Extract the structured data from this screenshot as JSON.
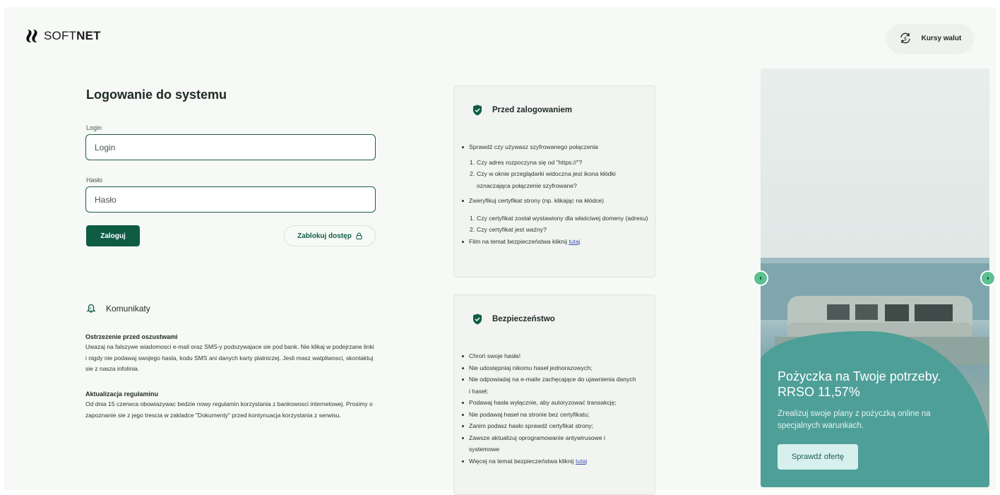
{
  "brand": {
    "name_light": "SOFT",
    "name_bold": "NET"
  },
  "header": {
    "fx_label": "Kursy walut",
    "fx_icon": "currency-exchange-icon"
  },
  "login": {
    "title": "Logowanie do systemu",
    "login_label": "Login",
    "login_placeholder": "Login",
    "password_label": "Hasło",
    "password_placeholder": "Hasło",
    "submit_label": "Zaloguj",
    "block_label": "Zablokuj dostęp",
    "block_icon": "lock-icon"
  },
  "messages": {
    "title": "Komunikaty",
    "icon": "bell-icon",
    "items": [
      {
        "title": "Ostrzezenie przed oszustwami",
        "body": "Uwazaj na falszywe wiadomosci e-mail oraz SMS-y podszywajace sie pod bank. Nie klikaj w podejrzane linki i nigdy nie podawaj swojego hasla, kodu SMS ani danych karty platniczej. Jesli masz watpliwosci, skontaktuj sie z nasza infolinia."
      },
      {
        "title": "Aktualizacja regulaminu",
        "body": "Od dnia 15 czerwca obowiazywac bedzie nowy regulamin korzystania z bankowosci internetowej. Prosimy o zapoznanie sie z jego trescia w zakladce \"Dokumenty\" przed kontynuacja korzystania z serwisu."
      }
    ]
  },
  "before_login": {
    "title": "Przed zalogowaniem",
    "icon": "shield-check-icon",
    "b1": "Sprawdź czy używasz szyfrowanego połączenia",
    "b1_sub": [
      "Czy adres rozpoczyna się od \"https://\"?",
      "Czy w oknie przeglądarki widoczna jest ikona kłódki oznaczająca połączenie szyfrowane?"
    ],
    "b2": "Zweryfikuj certyfikat strony (np. klikając na kłódce)",
    "b2_sub": [
      "Czy certyfikat został wystawiony dla właściwej domeny (adresu)",
      "Czy certyfikat jest ważny?"
    ],
    "b3": "Film na temat bezpieczeństwa kliknij",
    "b3_link": "tutaj"
  },
  "security": {
    "title": "Bezpieczeństwo",
    "icon": "shield-check-icon",
    "items": [
      "Chroń swoje hasła!",
      "Nie udostępniaj nikomu haseł jednorazowych;",
      "Nie odpowiadaj na e-maile zachęcające do ujawnienia danych i haseł;",
      "Podawaj hasła wyłącznie, aby autoryzować transakcję;",
      "Nie podawaj haseł na stronie bez certyfikatu;",
      "Zanim podasz hasło sprawdź certyfikat strony;",
      "Zawsze aktualizuj oprogramowanie antywirusowe i systemowe"
    ],
    "last": "Więcej na temat bezpieczeństwa kliknij",
    "last_link": "tutaj"
  },
  "banner": {
    "title": "Pożyczka na Twoje potrzeby. RRSO 11,57%",
    "subtitle": "Zrealizuj swoje plany z pożyczką online na specjalnych warunkach.",
    "cta": "Sprawdź ofertę",
    "prev_icon": "chevron-left-icon",
    "next_icon": "chevron-right-icon"
  },
  "colors": {
    "primary": "#0f5c45",
    "banner_teal": "#4e9f98",
    "accent_green": "#5cc090"
  }
}
